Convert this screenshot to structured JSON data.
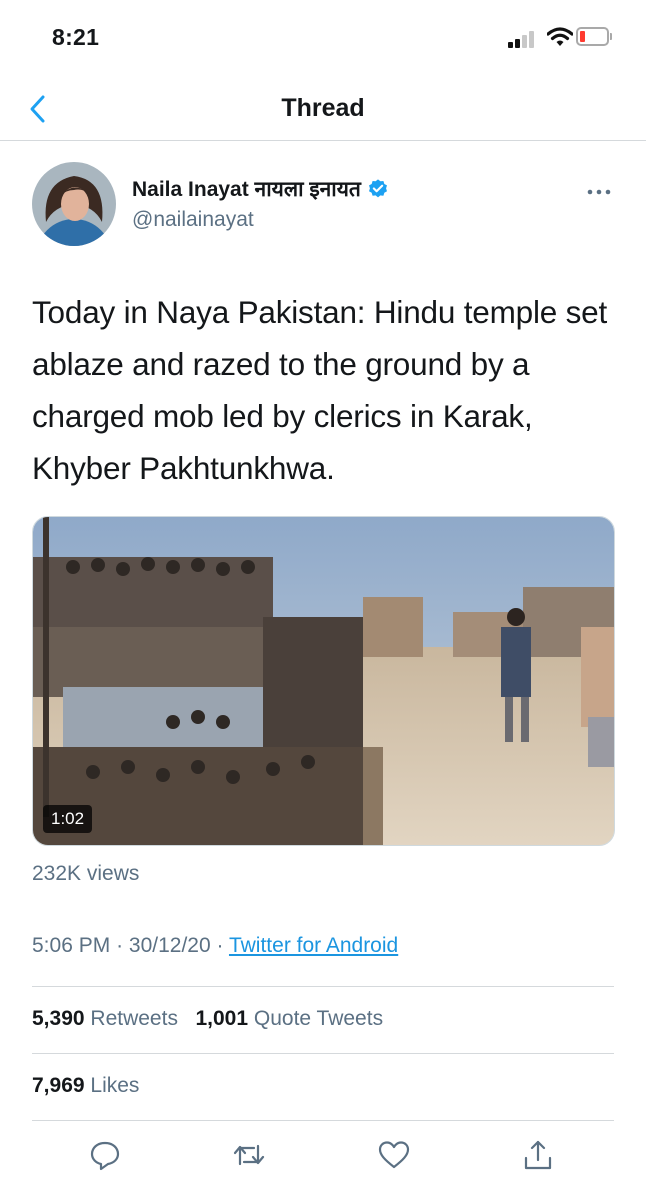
{
  "status_bar": {
    "time": "8:21"
  },
  "header": {
    "title": "Thread"
  },
  "tweet": {
    "author_name": "Naila Inayat नायला इनायत",
    "author_handle": "@nailainayat",
    "text": "Today in Naya Pakistan: Hindu temple set ablaze and razed to the ground by a charged mob led by clerics in Karak, Khyber Pakhtunkhwa.",
    "video_duration": "1:02",
    "views": "232K views",
    "time": "5:06 PM",
    "date": "30/12/20",
    "separator": "·",
    "source": "Twitter for Android",
    "retweets_count": "5,390",
    "retweets_label": "Retweets",
    "quote_count": "1,001",
    "quote_label": "Quote Tweets",
    "likes_count": "7,969",
    "likes_label": "Likes"
  },
  "colors": {
    "link": "#1b95e0",
    "verified": "#1da1f2",
    "secondary_text": "#5b7083",
    "battery_low": "#ff3b30"
  },
  "icons": [
    "back-chevron-icon",
    "verified-badge-icon",
    "more-options-icon",
    "reply-icon",
    "retweet-icon",
    "like-icon",
    "share-icon"
  ]
}
